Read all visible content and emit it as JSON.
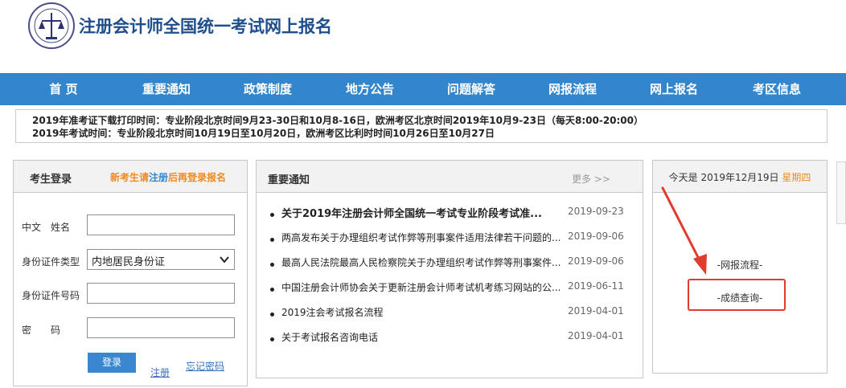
{
  "header": {
    "title": "注册会计师全国统一考试网上报名",
    "logo_icon": "cicpa-emblem-icon"
  },
  "nav": {
    "items": [
      "首 页",
      "重要通知",
      "政策制度",
      "地方公告",
      "问题解答",
      "网报流程",
      "网上报名",
      "考区信息"
    ],
    "bg_color": "#3386cc"
  },
  "notice": {
    "line1": "2019年准考证下载打印时间：专业阶段北京时间9月23-30日和10月8-16日，欧洲考区北京时间2019年10月9-23日（每天8:00-20:00）",
    "line2": "2019年考试时间：专业阶段北京时间10月19日至10月20日，欧洲考区比利时时间10月26日至10月27日"
  },
  "login": {
    "title": "考生登录",
    "tip_prefix": "新考生请",
    "tip_register": "注册",
    "tip_suffix": "后再登录报名",
    "fields": {
      "name_label": "中文　姓名",
      "id_type_label": "身份证件类型",
      "id_type_value": "内地居民身份证",
      "id_number_label": "身份证件号码",
      "password_label": "密　　码"
    },
    "login_button": "登录",
    "register_link": "注册",
    "forgot_link": "忘记密码"
  },
  "news": {
    "title": "重要通知",
    "more": "更多 >>",
    "items": [
      {
        "text": "关于2019年注册会计师全国统一考试专业阶段考试准...",
        "date": "2019-09-23"
      },
      {
        "text": "两高发布关于办理组织考试作弊等刑事案件适用法律若干问题的...",
        "date": "2019-09-06"
      },
      {
        "text": "最高人民法院最高人民检察院关于办理组织考试作弊等刑事案件...",
        "date": "2019-09-06"
      },
      {
        "text": "中国注册会计师协会关于更新注册会计师考试机考练习网站的公...",
        "date": "2019-06-11"
      },
      {
        "text": "2019注会考试报名流程",
        "date": "2019-04-01"
      },
      {
        "text": "关于考试报名咨询电话",
        "date": "2019-04-01"
      }
    ]
  },
  "side": {
    "today_prefix": "今天是 2019年12月19日",
    "weekday": "星期四",
    "link_process": "-网报流程-",
    "link_score": "-成绩查询-",
    "annotation_color": "#e23a2c"
  }
}
